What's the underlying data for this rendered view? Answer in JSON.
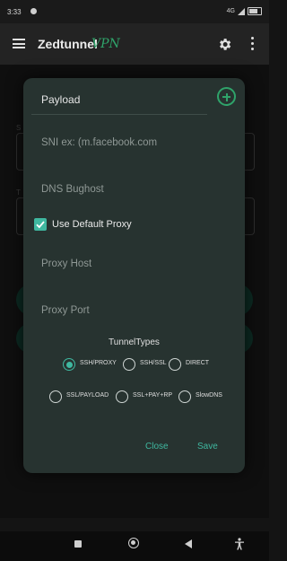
{
  "status_bar": {
    "time": "3:33",
    "network": "4G"
  },
  "app_bar": {
    "title": "Zedtunnel",
    "title_accent": "VPN",
    "accent_color": "#2fa36a"
  },
  "dialog": {
    "payload_label": "Payload",
    "sni_placeholder": "SNI ex: (m.facebook.com",
    "dns_placeholder": "DNS Bughost",
    "use_default_proxy_label": "Use Default Proxy",
    "use_default_proxy_checked": true,
    "proxy_host_placeholder": "Proxy Host",
    "proxy_port_placeholder": "Proxy Port",
    "tunnel_types_title": "TunnelTypes",
    "tunnel_types": [
      {
        "label": "SSH/PROXY",
        "selected": true
      },
      {
        "label": "SSH/SSL",
        "selected": false
      },
      {
        "label": "DIRECT",
        "selected": false
      },
      {
        "label": "SSL/PAYLOAD",
        "selected": false
      },
      {
        "label": "SSL+PAY+RP",
        "selected": false
      },
      {
        "label": "SlowDNS",
        "selected": false
      }
    ],
    "close_label": "Close",
    "save_label": "Save",
    "accent_color": "#3fb8a0"
  },
  "icons": {
    "menu": "menu-icon",
    "settings": "gear-icon",
    "more": "more-vert-icon",
    "add": "add-circle-icon",
    "nav_recents": "square-icon",
    "nav_home": "home-icon",
    "nav_back": "back-icon",
    "nav_accessibility": "accessibility-icon"
  }
}
